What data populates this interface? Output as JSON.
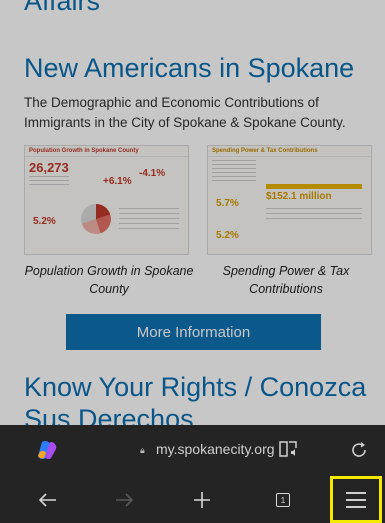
{
  "page": {
    "top_heading": "Affairs",
    "title": "New Americans in Spokane",
    "description": "The Demographic and Economic Contributions of Immigrants in the City of Spokane & Spokane County.",
    "thumb_left": {
      "heading": "Population Growth in Spokane County",
      "stat1": "26,273",
      "stat2": "+6.1%",
      "stat3": "-4.1%",
      "stat4": "5.2%"
    },
    "thumb_right": {
      "heading": "Spending Power & Tax Contributions",
      "stat1": "5.7%",
      "stat2": "$152.1 million",
      "stat3": "5.2%"
    },
    "caption_left": "Population Growth in Spokane County",
    "caption_right": "Spending Power & Tax Contributions",
    "more_button": "More Information",
    "know_title_line1": "Know Your Rights / Conozca",
    "know_title_line2": "Sus Derechos"
  },
  "browser": {
    "url": "my.spokanecity.org",
    "tab_count": "1",
    "icons": {
      "copilot": "copilot-icon",
      "lock": "lock-icon",
      "read_aloud": "read-aloud-icon",
      "reload": "reload-icon",
      "back": "back-arrow-icon",
      "forward": "forward-arrow-icon",
      "new_tab": "plus-icon",
      "tabs": "tabs-icon",
      "menu": "hamburger-menu-icon"
    },
    "colors": {
      "chrome_bg": "#242424",
      "link_blue": "#0d6fb0",
      "button_blue": "#0f71b3",
      "highlight": "#f4ea00"
    }
  }
}
